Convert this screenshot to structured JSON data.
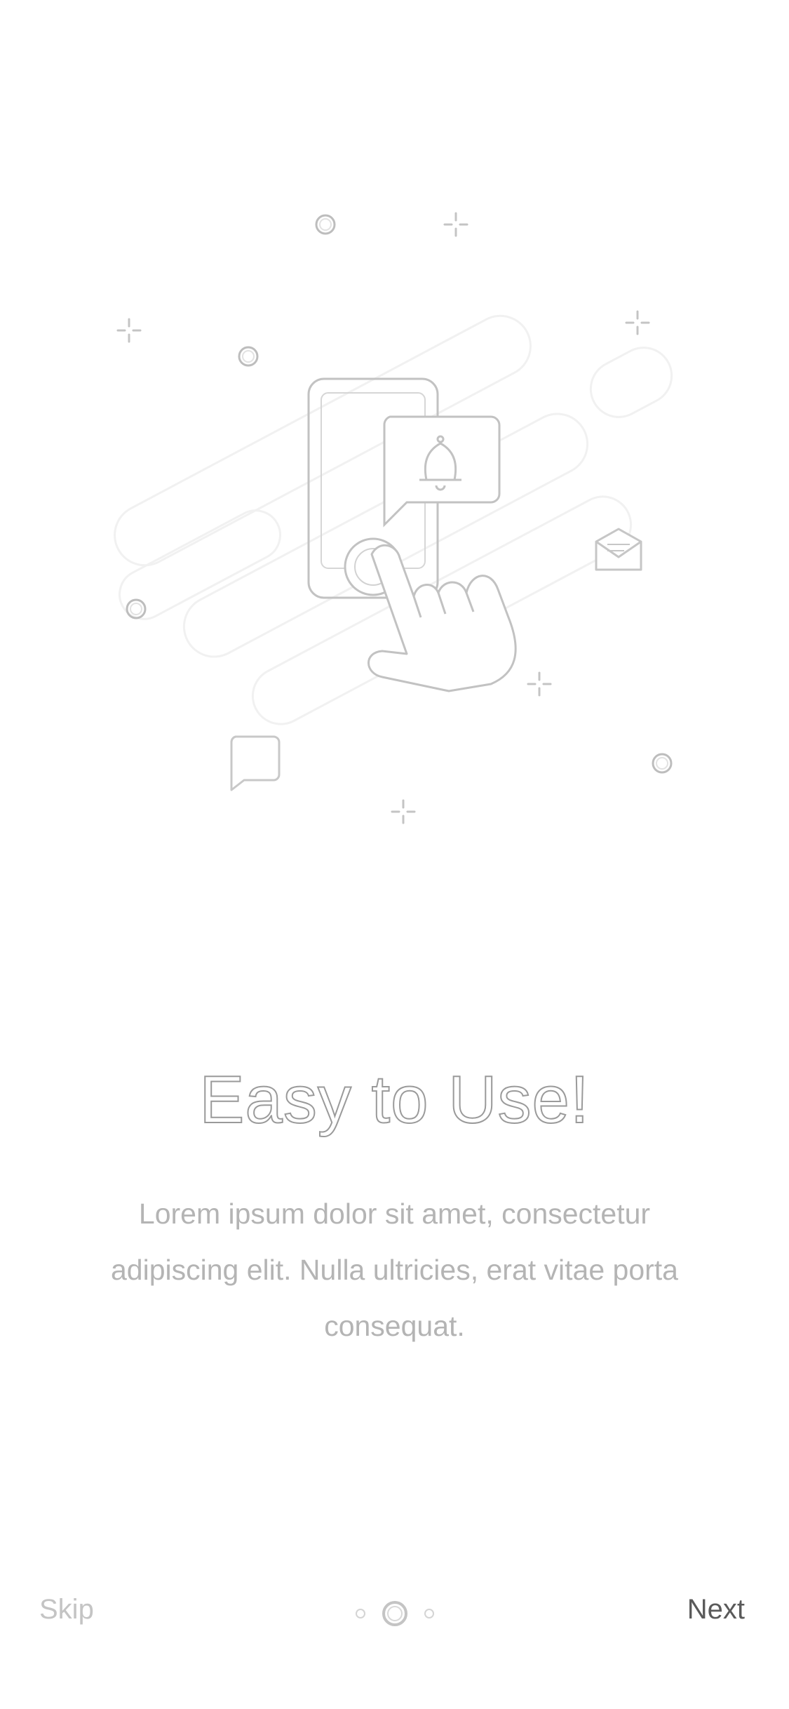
{
  "onboarding": {
    "title": "Easy to Use!",
    "description": "Lorem ipsum dolor sit amet, consectetur adipiscing elit. Nulla ultricies, erat vitae porta consequat.",
    "illustration_icons": [
      "phone-icon",
      "bell-notification-icon",
      "tapping-hand-icon",
      "envelope-icon",
      "chat-bubble-icon",
      "sparkle-icon",
      "ring-icon"
    ]
  },
  "nav": {
    "skip_label": "Skip",
    "next_label": "Next"
  },
  "pager": {
    "total": 3,
    "current": 2
  }
}
